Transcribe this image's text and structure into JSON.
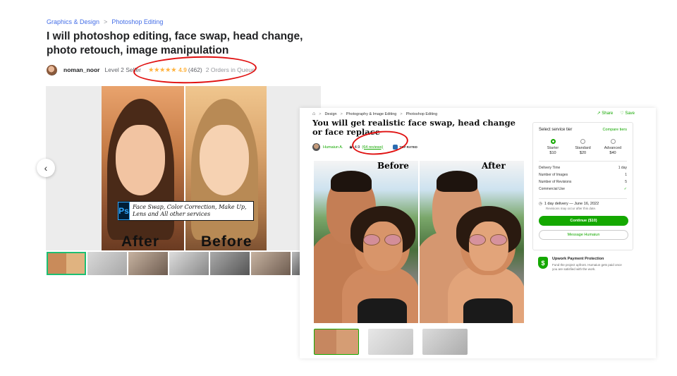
{
  "fiverr": {
    "breadcrumb": {
      "category": "Graphics & Design",
      "separator": ">",
      "subcategory": "Photoshop Editing"
    },
    "title": "I will photoshop editing, face swap, head change, photo retouch, image manipulation",
    "seller": {
      "name": "noman_noor",
      "level": "Level 2 Seller",
      "stars": "★★★★★",
      "rating": "4.9",
      "reviews": "(462)",
      "queue": "2 Orders in Queue"
    },
    "gallery": {
      "label_left": "After",
      "label_right": "Before",
      "ps_icon": "Ps",
      "banner_text": "Face Swap, Color Correction, Make Up, Lens and All other services",
      "prev_arrow": "‹"
    },
    "accent_color": "#1dbf73",
    "rating_color": "#ffb33e"
  },
  "upwork": {
    "breadcrumb": {
      "home_icon": "⌂",
      "items": [
        "Design",
        "Photography & Image Editing",
        "Photoshop Editing"
      ],
      "separator": ">"
    },
    "actions": {
      "share": "Share",
      "save": "Save"
    },
    "title": "You will get realistic face swap, head change or face replace",
    "seller": {
      "name": "Humaiun A.",
      "star": "★",
      "rating": "4.9",
      "reviews": "(64 reviews)",
      "badge": "TOP RATED"
    },
    "images": {
      "label_before": "Before",
      "label_after": "After"
    },
    "pricing": {
      "select_label": "Select service tier",
      "compare_label": "Compare tiers",
      "tiers": [
        {
          "name": "Starter",
          "price": "$10",
          "selected": true
        },
        {
          "name": "Standard",
          "price": "$20",
          "selected": false
        },
        {
          "name": "Advanced",
          "price": "$40",
          "selected": false
        }
      ],
      "details": [
        {
          "label": "Delivery Time",
          "value": "1 day"
        },
        {
          "label": "Number of Images",
          "value": "1"
        },
        {
          "label": "Number of Revisions",
          "value": "5"
        },
        {
          "label": "Commercial Use",
          "value": "✓"
        }
      ],
      "delivery_line": "1 day delivery — June 16, 2022",
      "delivery_note": "Revisions may occur after this date.",
      "continue_label": "Continue ($10)",
      "message_label": "Message Humaiun"
    },
    "protection": {
      "title": "Upwork Payment Protection",
      "text": "Fund the project upfront. Humaiun gets paid once you are satisfied with the work."
    },
    "accent_color": "#14a800"
  },
  "annotation_color": "#e01010"
}
